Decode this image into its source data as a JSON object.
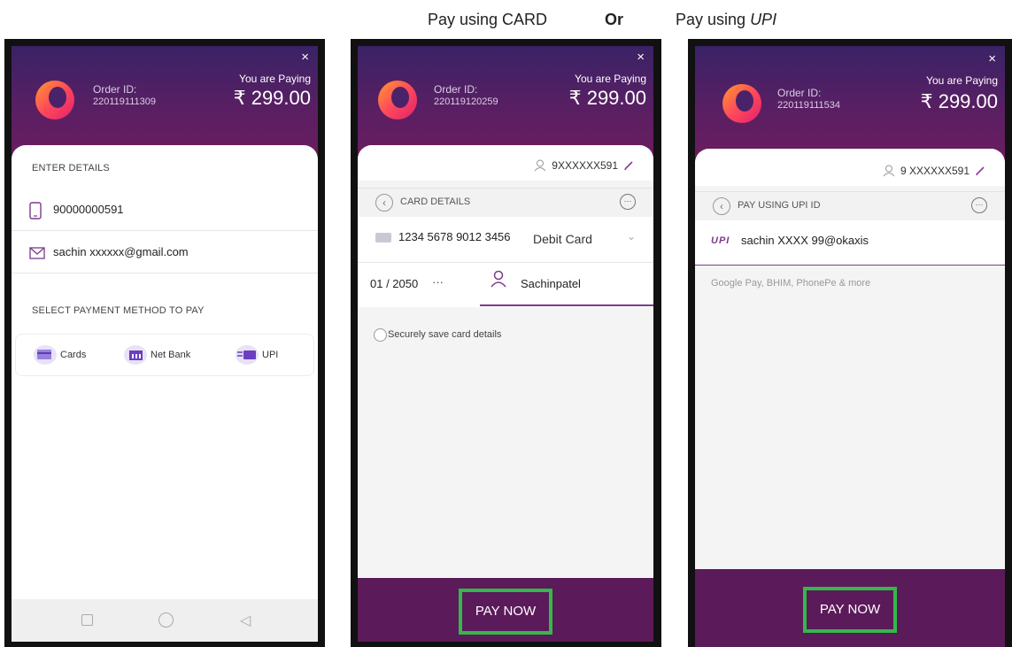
{
  "captions": {
    "card": "Pay using CARD",
    "or": "Or",
    "upi_prefix": "Pay using ",
    "upi_em": "UPI"
  },
  "common": {
    "order_label": "Order ID:",
    "paying_label": "You are Paying",
    "amount": "₹ 299.00",
    "close": "×",
    "pay_button": "PAY NOW"
  },
  "phone1": {
    "order_id": "220119111309",
    "enter_details": "ENTER DETAILS",
    "mobile": "90000000591",
    "email": "sachin xxxxxx@gmail.com",
    "select_method": "SELECT PAYMENT METHOD TO PAY",
    "methods": [
      "Cards",
      "Net Bank",
      "UPI"
    ]
  },
  "phone2": {
    "order_id": "220119120259",
    "phone": "9XXXXXX591",
    "section": "CARD DETAILS",
    "card_number": "1234 5678 9012 3456",
    "card_type": "Debit Card",
    "expiry": "01 / 2050",
    "cvv": "···",
    "name": "Sachinpatel",
    "save_label": "Securely save card details"
  },
  "phone3": {
    "order_id": "220119111534",
    "phone": "9 XXXXXX591",
    "section": "PAY USING UPI ID",
    "upi_tag": "UPI",
    "upi_id": "sachin XXXX 99@okaxis",
    "apps_hint": "Google Pay, BHIM, PhonePe & more"
  },
  "colors": {
    "header_top": "#3a2266",
    "header_bottom": "#6a1d5e",
    "footer": "#5b1a59",
    "highlight": "#34b84a",
    "accent": "#8a3a96"
  }
}
